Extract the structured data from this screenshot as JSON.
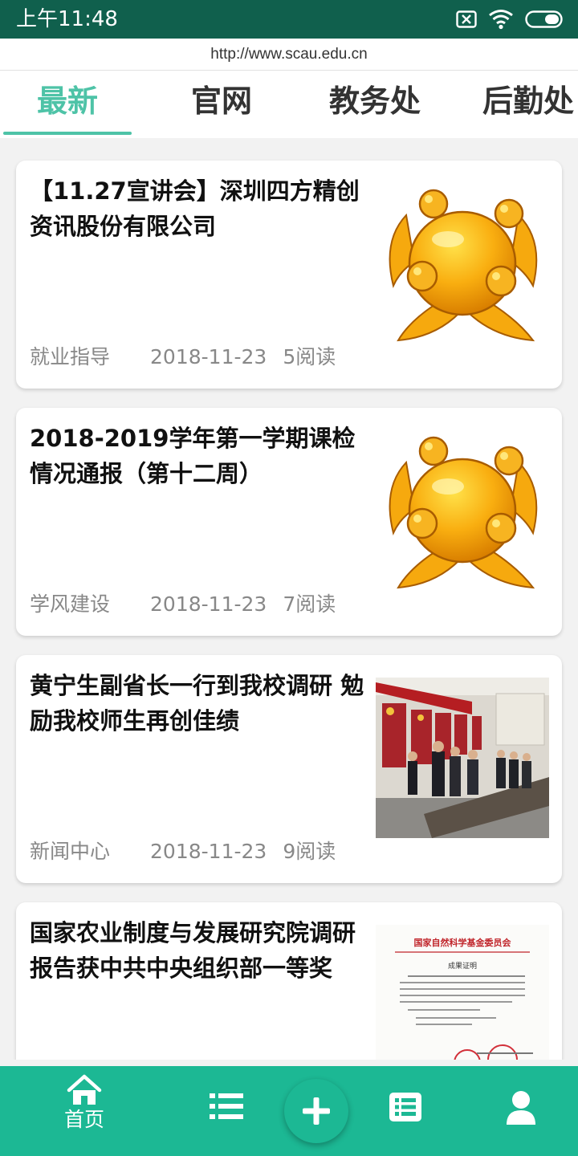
{
  "status_bar": {
    "time": "上午11:48",
    "icons": [
      "sim-off-icon",
      "wifi-icon",
      "battery-icon"
    ]
  },
  "url_bar": {
    "url": "http://www.scau.edu.cn"
  },
  "tabs": [
    {
      "label": "最新",
      "active": true
    },
    {
      "label": "官网",
      "active": false
    },
    {
      "label": "教务处",
      "active": false
    },
    {
      "label": "后勤处",
      "active": false
    }
  ],
  "articles": [
    {
      "title": "【11.27宣讲会】深圳四方精创资讯股份有限公司",
      "category": "就业指导",
      "date": "2018-11-23",
      "reads": "5阅读",
      "thumbnail": "mascot-image"
    },
    {
      "title": "2018-2019学年第一学期课检情况通报（第十二周）",
      "category": "学风建设",
      "date": "2018-11-23",
      "reads": "7阅读",
      "thumbnail": "mascot-image"
    },
    {
      "title": "黄宁生副省长一行到我校调研 勉励我校师生再创佳绩",
      "category": "新闻中心",
      "date": "2018-11-23",
      "reads": "9阅读",
      "thumbnail": "meeting-photo"
    },
    {
      "title": "国家农业制度与发展研究院调研报告获中共中央组织部一等奖",
      "thumbnail": "certificate-image",
      "thumbnail_heading": "国家自然科学基金委员会",
      "thumbnail_subheading": "成果证明"
    }
  ],
  "bottom_nav": {
    "items": [
      {
        "label": "首页",
        "icon": "home-icon",
        "active": true
      },
      {
        "icon": "list-icon"
      },
      {
        "icon": "add-icon"
      },
      {
        "icon": "checklist-icon"
      },
      {
        "icon": "user-icon"
      }
    ]
  },
  "colors": {
    "status_bar": "#10604d",
    "accent": "#4ec3a7",
    "nav_bar": "#1cb894",
    "card_bg": "#ffffff",
    "page_bg": "#f2f2f2"
  }
}
